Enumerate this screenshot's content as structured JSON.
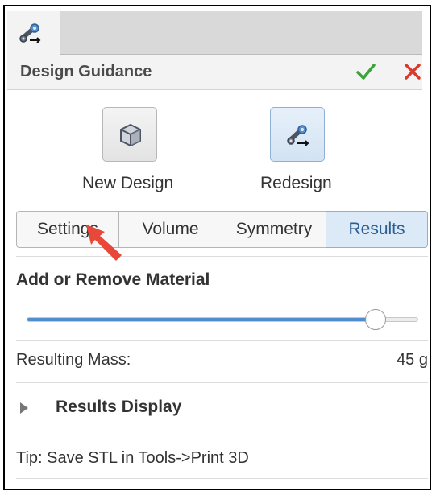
{
  "panel": {
    "title": "Design Guidance",
    "tab_icon": "design-guidance-icon",
    "ok_icon": "checkmark-icon",
    "cancel_icon": "close-icon"
  },
  "modes": {
    "new_design": {
      "label": "New Design",
      "icon": "cube-icon"
    },
    "redesign": {
      "label": "Redesign",
      "icon": "redesign-icon"
    }
  },
  "tabs": [
    {
      "label": "Settings",
      "selected": false
    },
    {
      "label": "Volume",
      "selected": false
    },
    {
      "label": "Symmetry",
      "selected": false
    },
    {
      "label": "Results",
      "selected": true
    }
  ],
  "material": {
    "title": "Add or Remove Material",
    "slider_fraction": 0.89
  },
  "mass": {
    "label": "Resulting Mass:",
    "value": "45 g"
  },
  "results_display": {
    "label": "Results Display",
    "icon": "expand-triangle-icon"
  },
  "tip": "Tip: Save STL in Tools->Print 3D",
  "colors": {
    "accent": "#4f8ed1",
    "selected_tab_bg": "#dce9f6",
    "ok_green": "#3aa33a",
    "cancel_red": "#d93a2b",
    "annotation_arrow": "#e8483a"
  }
}
